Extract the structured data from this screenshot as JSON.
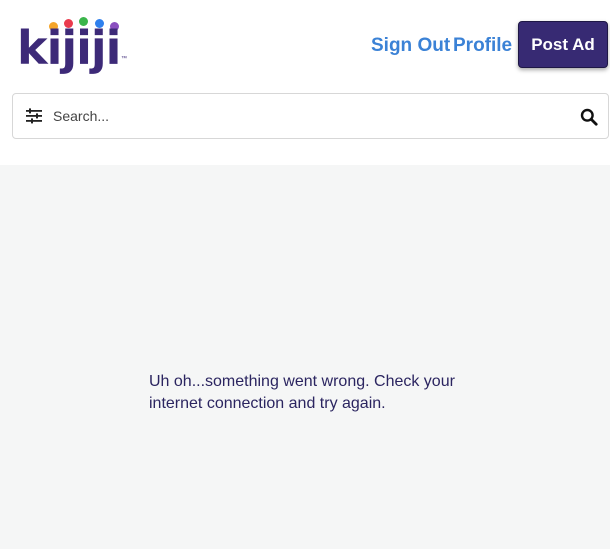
{
  "header": {
    "logo_text": "kijiji",
    "logo_trademark": "™",
    "logo_dot_colors": [
      "#f4a52b",
      "#ea3b4e",
      "#3ab54a",
      "#2f80ed",
      "#8a4fbf"
    ],
    "sign_out_label": "Sign Out",
    "profile_label": "Profile",
    "post_ad_label": "Post Ad"
  },
  "search": {
    "placeholder": "Search...",
    "value": ""
  },
  "main": {
    "error_message": "Uh oh...something went wrong. Check your internet connection and try again."
  },
  "colors": {
    "brand_purple": "#372a73",
    "link_blue": "#3b82d6",
    "content_background": "#f5f6f6"
  },
  "icons": {
    "filter": "filter-sliders-icon",
    "search": "search-icon"
  }
}
